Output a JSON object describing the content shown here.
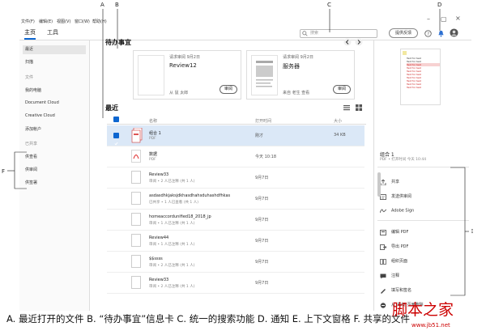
{
  "callouts": {
    "A": "A",
    "B": "B",
    "C": "C",
    "D": "D",
    "E": "E",
    "F": "F"
  },
  "menu": [
    "文件(F)",
    "编辑(E)",
    "视图(V)",
    "窗口(W)",
    "帮助(H)"
  ],
  "tabs": {
    "home": "主页",
    "tools": "工具"
  },
  "search": {
    "placeholder": "搜索"
  },
  "feedback_button": "提供反馈",
  "sidebar": {
    "recent": "最近",
    "scan": "扫描",
    "files_header": "文件",
    "my_computer": "我的电脑",
    "document_cloud": "Document Cloud",
    "creative_cloud": "Creative Cloud",
    "add_account": "添加帐户",
    "shared_header": "已共享",
    "shared_by_me": "供查看",
    "shared_review": "供审阅",
    "shared_sign": "供签署"
  },
  "todo": {
    "title": "待办事宜",
    "cards": [
      {
        "meta": "请求审阅 9月2日",
        "title": "Review12",
        "sender": "从 鼠 太郎",
        "button": "审阅"
      },
      {
        "meta": "请求审阅 9月2日",
        "title": "服务器",
        "sender": "来自 老生 查看",
        "button": "审阅"
      }
    ]
  },
  "recent": {
    "title": "最近",
    "columns": {
      "name": "名称",
      "opened": "打开时间",
      "size": "大小"
    },
    "rows": [
      {
        "name": "组合 1",
        "sub": "PDF",
        "opened": "刚才",
        "size": "34 KB"
      },
      {
        "name": "数据",
        "sub": "PDF",
        "opened": "今天 10:18",
        "size": ""
      },
      {
        "name": "Review33",
        "sub": "审阅 • 2 人已注释 (共 1 人)",
        "opened": "9月7日",
        "size": ""
      },
      {
        "name": "asdasdhkjaksjdkhasdhahsduhashdfhkas",
        "sub": "已共享 • 1 人已查看 (共 1 人)",
        "opened": "9月7日",
        "size": ""
      },
      {
        "name": "homeaccordunified18_2018_jp",
        "sub": "审阅 • 1 人已注释 (共 1 人)",
        "opened": "9月7日",
        "size": ""
      },
      {
        "name": "Review44",
        "sub": "审阅 • 1 人已注释 (共 1 人)",
        "opened": "9月7日",
        "size": ""
      },
      {
        "name": "$$ssss",
        "sub": "审阅 • 2 人已注释 (共 1 人)",
        "opened": "9月7日",
        "size": ""
      },
      {
        "name": "Review33",
        "sub": "审阅 • 2 人已注释 (共 1 人)",
        "opened": "9月7日",
        "size": ""
      }
    ]
  },
  "right_panel": {
    "file_name": "组合 1",
    "file_meta": "PDF • 打开时间 今天 10:44",
    "thumb_text": [
      "Text for test",
      "Text for test",
      "Text for test",
      "Text for test",
      "Text for test",
      "Text for test",
      "Text for test",
      "Text for test",
      "Text for test",
      "Text for test"
    ],
    "actions": [
      "共享",
      "发送供审阅",
      "Adobe Sign",
      "编辑 PDF",
      "导出 PDF",
      "组织页面",
      "注释",
      "填写和签名",
      "从\"高级\"页面删除"
    ]
  },
  "caption": "A. 最近打开的文件 B. “待办事宜”信息卡 C. 统一的搜索功能 D. 通知 E. 上下文窗格 F. 共享的文件",
  "watermark": {
    "main": "脚本之家",
    "url": "www.jb51.net"
  },
  "colors": {
    "accent": "#0d66d0",
    "selected_row": "#dbe8f7",
    "watermark": "#cc0000"
  }
}
